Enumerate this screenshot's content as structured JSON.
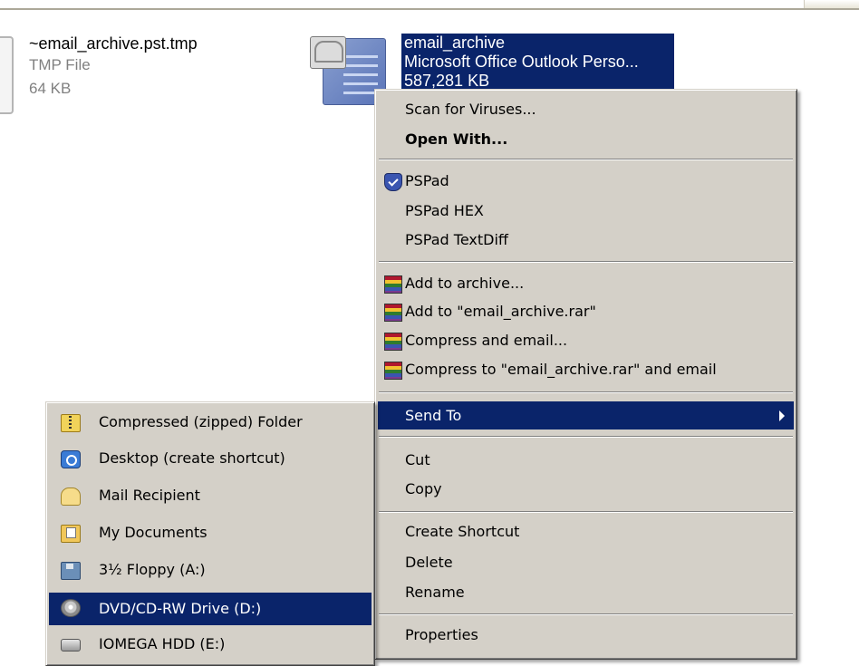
{
  "files": [
    {
      "name": "~email_archive.pst.tmp",
      "type": "TMP File",
      "size": "64 KB"
    },
    {
      "name": "email_archive",
      "type": "Microsoft Office Outlook Perso...",
      "size": "587,281 KB"
    }
  ],
  "context_menu": {
    "items": [
      {
        "label": "Scan for Viruses...",
        "icon": ""
      },
      {
        "label": "Open With...",
        "icon": ""
      },
      {
        "label": "PSPad",
        "icon": "pspad-icon"
      },
      {
        "label": "PSPad HEX",
        "icon": ""
      },
      {
        "label": "PSPad TextDiff",
        "icon": ""
      },
      {
        "label": "Add to archive...",
        "icon": "winrar-icon"
      },
      {
        "label": "Add to \"email_archive.rar\"",
        "icon": "winrar-icon"
      },
      {
        "label": "Compress and email...",
        "icon": "winrar-icon"
      },
      {
        "label": "Compress to \"email_archive.rar\" and email",
        "icon": "winrar-icon"
      },
      {
        "label": "Send To",
        "icon": "",
        "highlighted": true
      },
      {
        "label": "Cut",
        "icon": ""
      },
      {
        "label": "Copy",
        "icon": ""
      },
      {
        "label": "Create Shortcut",
        "icon": ""
      },
      {
        "label": "Delete",
        "icon": ""
      },
      {
        "label": "Rename",
        "icon": ""
      },
      {
        "label": "Properties",
        "icon": ""
      }
    ]
  },
  "send_to_menu": {
    "items": [
      {
        "label": "Compressed (zipped) Folder",
        "icon": "zipped-folder-icon"
      },
      {
        "label": "Desktop (create shortcut)",
        "icon": "desktop-icon"
      },
      {
        "label": "Mail Recipient",
        "icon": "mail-icon"
      },
      {
        "label": "My Documents",
        "icon": "my-documents-icon"
      },
      {
        "label": "3½ Floppy (A:)",
        "icon": "floppy-drive-icon"
      },
      {
        "label": "DVD/CD-RW Drive (D:)",
        "icon": "dvd-drive-icon",
        "highlighted": true
      },
      {
        "label": "IOMEGA HDD (E:)",
        "icon": "hard-drive-icon"
      }
    ]
  },
  "colors": {
    "selection": "#0a246a",
    "menu_bg": "#d4d0c8"
  }
}
